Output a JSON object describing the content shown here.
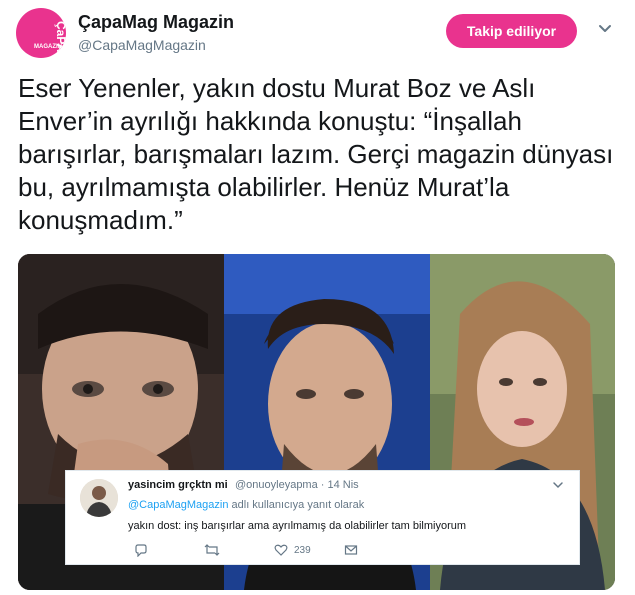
{
  "account": {
    "display_name": "ÇapaMag Magazin",
    "handle": "@CapaMagMagazin",
    "avatar_text": "ÇaPA",
    "avatar_sub": "MAGAZIN",
    "brand_color": "#e9338e"
  },
  "follow_button": {
    "label": "Takip ediliyor"
  },
  "tweet": {
    "text": "Eser Yenenler, yakın dostu Murat Boz ve Aslı Enver’in ayrılığı hakkında konuştu:  “İnşallah barışırlar, barışmaları lazım. Gerçi magazin dünyası bu, ayrılmamışta olabilirler. Henüz Murat’la konuşmadım.”"
  },
  "reply": {
    "display_name": "yasincim grçktn mi",
    "handle_time": "@onuoyleyapma · 14 Nis",
    "reply_prefix_mention": "@CapaMagMagazin",
    "reply_suffix": " adlı kullanıcıya yanıt olarak",
    "text": "yakın dost: inş barışırlar ama ayrılmamış da olabilirler tam bilmiyorum",
    "like_count": "239",
    "icons": [
      "reply-icon",
      "retweet-icon",
      "like-icon",
      "dm-icon"
    ]
  }
}
